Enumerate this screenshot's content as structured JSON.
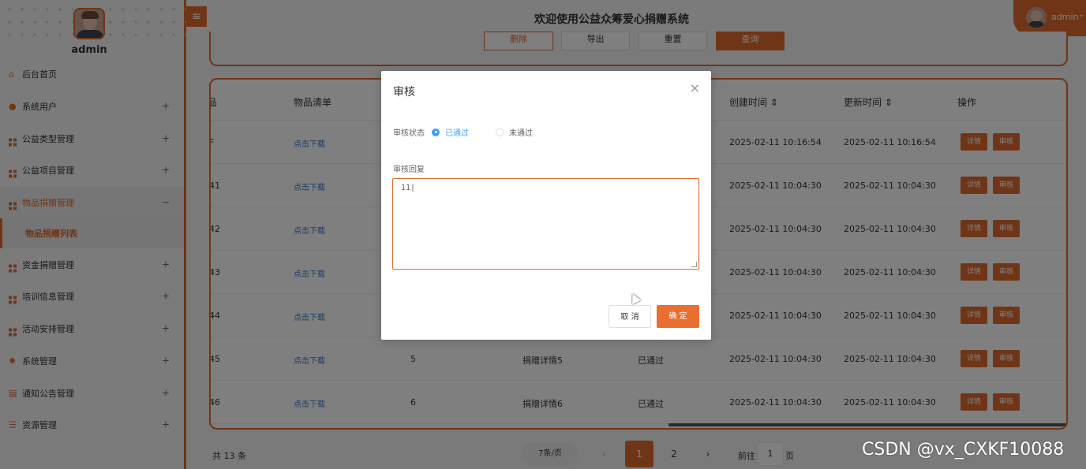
{
  "app": {
    "title": "欢迎使用公益众筹爱心捐赠系统",
    "hamburger": "≡",
    "user_name": "admin",
    "user_caret": "⌄"
  },
  "sidebar": {
    "user": "admin",
    "items": [
      {
        "label": "后台首页",
        "icon": "home-icon",
        "toggle": ""
      },
      {
        "label": "系统用户",
        "icon": "user-icon",
        "toggle": "+"
      },
      {
        "label": "公益类型管理",
        "icon": "grid-icon",
        "toggle": "+"
      },
      {
        "label": "公益项目管理",
        "icon": "grid-icon",
        "toggle": "+"
      },
      {
        "label": "物品捐赠管理",
        "icon": "grid-icon",
        "toggle": "−"
      },
      {
        "label": "资金捐赠管理",
        "icon": "grid-icon",
        "toggle": "+"
      },
      {
        "label": "培训信息管理",
        "icon": "grid-icon",
        "toggle": "+"
      },
      {
        "label": "活动安排管理",
        "icon": "grid-icon",
        "toggle": "+"
      },
      {
        "label": "系统管理",
        "icon": "gear-icon",
        "toggle": "+"
      },
      {
        "label": "通知公告管理",
        "icon": "notice-icon",
        "toggle": "+"
      },
      {
        "label": "资源管理",
        "icon": "database-icon",
        "toggle": "+"
      }
    ],
    "sub_active": "物品捐赠列表"
  },
  "search": {
    "buttons": [
      "删除",
      "导出",
      "重置",
      "查询"
    ]
  },
  "table": {
    "headers": [
      "品",
      "物品清单",
      "创建时间 ⇕",
      "更新时间 ⇕",
      "操作"
    ],
    "rows": [
      {
        "c0": "F",
        "c1": "点击下载",
        "c2": "",
        "c3": "",
        "c4": "",
        "created": "2025-02-11 10:16:54",
        "updated": "2025-02-11 10:16:54"
      },
      {
        "c0": "41",
        "c1": "点击下载",
        "c2": "",
        "c3": "",
        "c4": "",
        "created": "2025-02-11 10:04:30",
        "updated": "2025-02-11 10:04:30"
      },
      {
        "c0": "42",
        "c1": "点击下载",
        "c2": "",
        "c3": "",
        "c4": "",
        "created": "2025-02-11 10:04:30",
        "updated": "2025-02-11 10:04:30"
      },
      {
        "c0": "43",
        "c1": "点击下载",
        "c2": "",
        "c3": "",
        "c4": "",
        "created": "2025-02-11 10:04:30",
        "updated": "2025-02-11 10:04:30"
      },
      {
        "c0": "44",
        "c1": "点击下载",
        "c2": "",
        "c3": "",
        "c4": "",
        "created": "2025-02-11 10:04:30",
        "updated": "2025-02-11 10:04:30"
      },
      {
        "c0": "45",
        "c1": "点击下载",
        "c2": "5",
        "c3": "捐赠详情5",
        "c4": "已通过",
        "created": "2025-02-11 10:04:30",
        "updated": "2025-02-11 10:04:30"
      },
      {
        "c0": "46",
        "c1": "点击下载",
        "c2": "6",
        "c3": "捐赠详情6",
        "c4": "已通过",
        "created": "2025-02-11 10:04:30",
        "updated": "2025-02-11 10:04:30"
      }
    ],
    "detail_label": "详情",
    "review_label": "审核"
  },
  "pager": {
    "total": "共 13 条",
    "page_size": "7条/页",
    "prev": "‹",
    "pages": [
      "1",
      "2"
    ],
    "next": "›",
    "goto_prefix": "前往",
    "goto_value": "1",
    "goto_suffix": "页"
  },
  "modal": {
    "title": "审核",
    "close": "×",
    "status_label": "审核状态",
    "opt_pass": "已通过",
    "opt_fail": "未通过",
    "reply_label": "审核回复",
    "reply_value": "11|",
    "cancel": "取 消",
    "confirm": "确 定"
  },
  "watermark": "CSDN @vx_CXKF10088"
}
